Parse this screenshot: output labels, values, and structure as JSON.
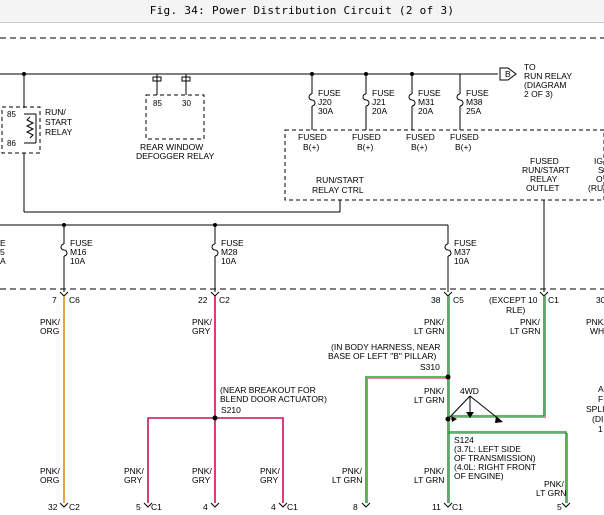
{
  "title": "Fig. 34: Power Distribution Circuit (2 of 3)",
  "offpage": {
    "letter": "B",
    "lines": [
      "TO",
      "RUN RELAY",
      "(DIAGRAM",
      "2 OF 3)"
    ]
  },
  "run_start_relay": {
    "lines": [
      "RUN/",
      "START",
      "RELAY"
    ],
    "pin_top": "85",
    "pin_bottom": "86"
  },
  "rear_defogger_relay": {
    "lines": [
      "REAR WINDOW",
      "DEFOGGER RELAY"
    ],
    "pin_left": "85",
    "pin_right": "30"
  },
  "top_fuses": [
    {
      "lines": [
        "FUSE",
        "J20",
        "30A"
      ]
    },
    {
      "lines": [
        "FUSE",
        "J21",
        "20A"
      ]
    },
    {
      "lines": [
        "FUSE",
        "M31",
        "20A"
      ]
    },
    {
      "lines": [
        "FUSE",
        "M38",
        "25A"
      ]
    }
  ],
  "fused_outputs": [
    {
      "lines": [
        "FUSED",
        "B(+)"
      ]
    },
    {
      "lines": [
        "FUSED",
        "B(+)"
      ]
    },
    {
      "lines": [
        "FUSED",
        "B(+)"
      ]
    },
    {
      "lines": [
        "FUSED",
        "B(+)"
      ]
    }
  ],
  "run_start_relay_ctrl": {
    "lines": [
      "RUN/START",
      "RELAY CTRL"
    ]
  },
  "fused_run_start_relay_outlet": {
    "lines": [
      "FUSED",
      "RUN/START",
      "RELAY",
      "OUTLET"
    ]
  },
  "partial_right_top": {
    "lines": [
      "IG",
      "S",
      "O",
      "(RUN"
    ]
  },
  "partial_left_fuse": {
    "lines": [
      "E",
      "5",
      "A"
    ]
  },
  "mid_fuses": [
    {
      "lines": [
        "FUSE",
        "M16",
        "10A"
      ]
    },
    {
      "lines": [
        "FUSE",
        "M28",
        "10A"
      ]
    },
    {
      "lines": [
        "FUSE",
        "M37",
        "10A"
      ]
    }
  ],
  "top_connectors": [
    {
      "pin": "7",
      "conn": "C6"
    },
    {
      "pin": "22",
      "conn": "C2"
    },
    {
      "pin": "38",
      "conn": "C5"
    },
    {
      "pin": "",
      "conn": "C1"
    },
    {
      "pin": "30",
      "conn": ""
    }
  ],
  "except_note": [
    "(EXCEPT 10",
    "RLE)"
  ],
  "wire_labels": {
    "w1": [
      "PNK/",
      "ORG"
    ],
    "w2": [
      "PNK/",
      "GRY"
    ],
    "w3": [
      "PNK/",
      "LT GRN"
    ],
    "w4": [
      "PNK/",
      "LT GRN"
    ],
    "w5": [
      "PNK/",
      "WH"
    ],
    "w6": [
      "PNK/",
      "LT GRN"
    ],
    "b1": [
      "PNK/",
      "ORG"
    ],
    "b2": [
      "PNK/",
      "GRY"
    ],
    "b3": [
      "PNK/",
      "GRY"
    ],
    "b4": [
      "PNK/",
      "GRY"
    ],
    "b5": [
      "PNK/",
      "LT GRN"
    ],
    "b6": [
      "PNK/",
      "LT GRN"
    ],
    "b7": [
      "PNK/",
      "LT GRN"
    ]
  },
  "s310": {
    "note": [
      "(IN BODY HARNESS, NEAR",
      "BASE OF LEFT \"B\" PILLAR)"
    ],
    "id": "S310"
  },
  "s210": {
    "note": [
      "(NEAR BREAKOUT FOR",
      "BLEND DOOR ACTUATOR)"
    ],
    "id": "S210"
  },
  "s124": {
    "id": "S124",
    "note": [
      "(3.7L: LEFT SIDE",
      "OF TRANSMISSION)",
      "(4.0L: RIGHT FRONT",
      "OF ENGINE)"
    ]
  },
  "fourwd": "4WD",
  "partial_right_mid": {
    "lines": [
      "A",
      "F",
      "SPLI",
      "(DI",
      "1"
    ]
  },
  "bottom_connectors": [
    {
      "pin": "32",
      "conn": "C2"
    },
    {
      "pin": "5",
      "conn": "C1"
    },
    {
      "pin": "4",
      "conn": ""
    },
    {
      "pin": "4",
      "conn": "C1"
    },
    {
      "pin": "8",
      "conn": ""
    },
    {
      "pin": "11",
      "conn": "C1"
    },
    {
      "pin": "5",
      "conn": ""
    }
  ],
  "colors": {
    "orange": "#e08a1e",
    "pink": "#c8105a",
    "green": "#2e9d2e",
    "wire": "#000000"
  }
}
